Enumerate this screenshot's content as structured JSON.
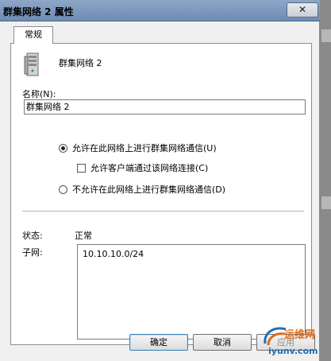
{
  "window": {
    "title": "群集网络 2 属性",
    "close_glyph": "✕"
  },
  "tabs": [
    {
      "label": "常规",
      "selected": true
    }
  ],
  "general": {
    "network_name": "群集网络 2",
    "name_label": "名称(N):",
    "name_value": "群集网络 2",
    "options": {
      "allow_cluster": {
        "label": "允许在此网络上进行群集网络通信(U)",
        "selected": true
      },
      "allow_clients": {
        "label": "允许客户端通过该网络连接(C)",
        "checked": false
      },
      "disallow_cluster": {
        "label": "不允许在此网络上进行群集网络通信(D)",
        "selected": false
      }
    },
    "status_label": "状态:",
    "status_value": "正常",
    "subnet_label": "子网:",
    "subnets": [
      "10.10.10.0/24"
    ]
  },
  "buttons": {
    "ok": "确定",
    "cancel": "取消",
    "apply": "应用"
  },
  "watermark": {
    "title": "运维网",
    "url": "iyunv.com"
  },
  "colors": {
    "titlebar": "#7d97bd",
    "accent_orange": "#e06a1a",
    "accent_blue": "#1f6fb8"
  },
  "icons": {
    "network": "server-icon",
    "close": "close-icon"
  }
}
